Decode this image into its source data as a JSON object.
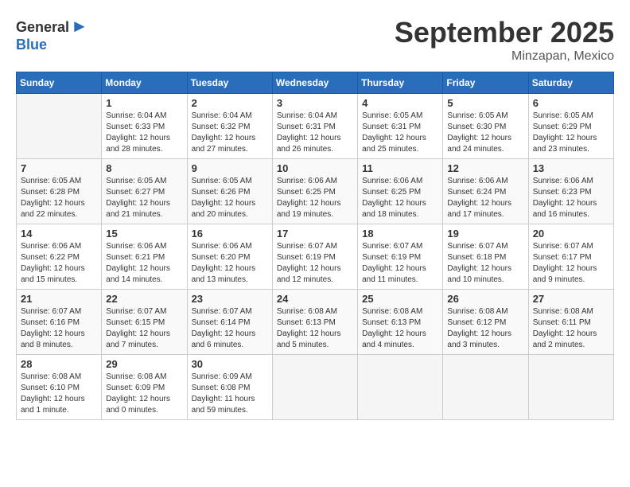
{
  "header": {
    "logo": {
      "general": "General",
      "blue": "Blue"
    },
    "title": "September 2025",
    "subtitle": "Minzapan, Mexico"
  },
  "calendar": {
    "days_of_week": [
      "Sunday",
      "Monday",
      "Tuesday",
      "Wednesday",
      "Thursday",
      "Friday",
      "Saturday"
    ],
    "weeks": [
      [
        {
          "day": "",
          "info": ""
        },
        {
          "day": "1",
          "info": "Sunrise: 6:04 AM\nSunset: 6:33 PM\nDaylight: 12 hours\nand 28 minutes."
        },
        {
          "day": "2",
          "info": "Sunrise: 6:04 AM\nSunset: 6:32 PM\nDaylight: 12 hours\nand 27 minutes."
        },
        {
          "day": "3",
          "info": "Sunrise: 6:04 AM\nSunset: 6:31 PM\nDaylight: 12 hours\nand 26 minutes."
        },
        {
          "day": "4",
          "info": "Sunrise: 6:05 AM\nSunset: 6:31 PM\nDaylight: 12 hours\nand 25 minutes."
        },
        {
          "day": "5",
          "info": "Sunrise: 6:05 AM\nSunset: 6:30 PM\nDaylight: 12 hours\nand 24 minutes."
        },
        {
          "day": "6",
          "info": "Sunrise: 6:05 AM\nSunset: 6:29 PM\nDaylight: 12 hours\nand 23 minutes."
        }
      ],
      [
        {
          "day": "7",
          "info": "Sunrise: 6:05 AM\nSunset: 6:28 PM\nDaylight: 12 hours\nand 22 minutes."
        },
        {
          "day": "8",
          "info": "Sunrise: 6:05 AM\nSunset: 6:27 PM\nDaylight: 12 hours\nand 21 minutes."
        },
        {
          "day": "9",
          "info": "Sunrise: 6:05 AM\nSunset: 6:26 PM\nDaylight: 12 hours\nand 20 minutes."
        },
        {
          "day": "10",
          "info": "Sunrise: 6:06 AM\nSunset: 6:25 PM\nDaylight: 12 hours\nand 19 minutes."
        },
        {
          "day": "11",
          "info": "Sunrise: 6:06 AM\nSunset: 6:25 PM\nDaylight: 12 hours\nand 18 minutes."
        },
        {
          "day": "12",
          "info": "Sunrise: 6:06 AM\nSunset: 6:24 PM\nDaylight: 12 hours\nand 17 minutes."
        },
        {
          "day": "13",
          "info": "Sunrise: 6:06 AM\nSunset: 6:23 PM\nDaylight: 12 hours\nand 16 minutes."
        }
      ],
      [
        {
          "day": "14",
          "info": "Sunrise: 6:06 AM\nSunset: 6:22 PM\nDaylight: 12 hours\nand 15 minutes."
        },
        {
          "day": "15",
          "info": "Sunrise: 6:06 AM\nSunset: 6:21 PM\nDaylight: 12 hours\nand 14 minutes."
        },
        {
          "day": "16",
          "info": "Sunrise: 6:06 AM\nSunset: 6:20 PM\nDaylight: 12 hours\nand 13 minutes."
        },
        {
          "day": "17",
          "info": "Sunrise: 6:07 AM\nSunset: 6:19 PM\nDaylight: 12 hours\nand 12 minutes."
        },
        {
          "day": "18",
          "info": "Sunrise: 6:07 AM\nSunset: 6:19 PM\nDaylight: 12 hours\nand 11 minutes."
        },
        {
          "day": "19",
          "info": "Sunrise: 6:07 AM\nSunset: 6:18 PM\nDaylight: 12 hours\nand 10 minutes."
        },
        {
          "day": "20",
          "info": "Sunrise: 6:07 AM\nSunset: 6:17 PM\nDaylight: 12 hours\nand 9 minutes."
        }
      ],
      [
        {
          "day": "21",
          "info": "Sunrise: 6:07 AM\nSunset: 6:16 PM\nDaylight: 12 hours\nand 8 minutes."
        },
        {
          "day": "22",
          "info": "Sunrise: 6:07 AM\nSunset: 6:15 PM\nDaylight: 12 hours\nand 7 minutes."
        },
        {
          "day": "23",
          "info": "Sunrise: 6:07 AM\nSunset: 6:14 PM\nDaylight: 12 hours\nand 6 minutes."
        },
        {
          "day": "24",
          "info": "Sunrise: 6:08 AM\nSunset: 6:13 PM\nDaylight: 12 hours\nand 5 minutes."
        },
        {
          "day": "25",
          "info": "Sunrise: 6:08 AM\nSunset: 6:13 PM\nDaylight: 12 hours\nand 4 minutes."
        },
        {
          "day": "26",
          "info": "Sunrise: 6:08 AM\nSunset: 6:12 PM\nDaylight: 12 hours\nand 3 minutes."
        },
        {
          "day": "27",
          "info": "Sunrise: 6:08 AM\nSunset: 6:11 PM\nDaylight: 12 hours\nand 2 minutes."
        }
      ],
      [
        {
          "day": "28",
          "info": "Sunrise: 6:08 AM\nSunset: 6:10 PM\nDaylight: 12 hours\nand 1 minute."
        },
        {
          "day": "29",
          "info": "Sunrise: 6:08 AM\nSunset: 6:09 PM\nDaylight: 12 hours\nand 0 minutes."
        },
        {
          "day": "30",
          "info": "Sunrise: 6:09 AM\nSunset: 6:08 PM\nDaylight: 11 hours\nand 59 minutes."
        },
        {
          "day": "",
          "info": ""
        },
        {
          "day": "",
          "info": ""
        },
        {
          "day": "",
          "info": ""
        },
        {
          "day": "",
          "info": ""
        }
      ]
    ]
  }
}
